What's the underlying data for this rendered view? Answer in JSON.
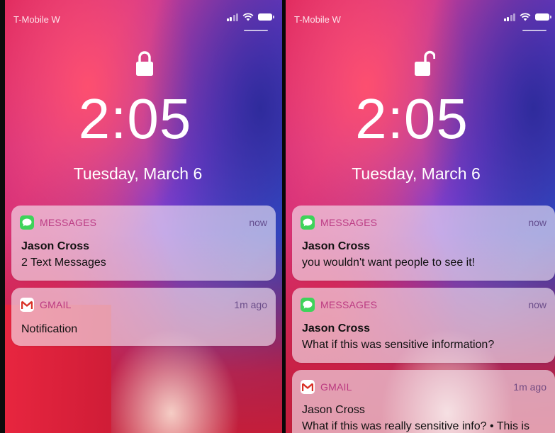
{
  "left": {
    "carrier": "T-Mobile W",
    "time": "2:05",
    "date": "Tuesday, March 6",
    "notifications": [
      {
        "app": "MESSAGES",
        "age": "now",
        "title": "Jason Cross",
        "body": "2 Text Messages"
      },
      {
        "app": "GMAIL",
        "age": "1m ago",
        "title": "",
        "body": "Notification"
      }
    ]
  },
  "right": {
    "carrier": "T-Mobile W",
    "time": "2:05",
    "date": "Tuesday, March 6",
    "notifications": [
      {
        "app": "MESSAGES",
        "age": "now",
        "title": "Jason Cross",
        "body": "you wouldn't want people to see it!"
      },
      {
        "app": "MESSAGES",
        "age": "now",
        "title": "Jason Cross",
        "body": "What if this was sensitive information?"
      },
      {
        "app": "GMAIL",
        "age": "1m ago",
        "title": "Jason Cross",
        "body": "What if this was really sensitive info? • This is"
      }
    ]
  },
  "icons": {
    "lock_left": "lock-closed-icon",
    "lock_right": "lock-open-icon",
    "messages": "messages-app-icon",
    "gmail": "gmail-app-icon",
    "signal": "cellular-signal-icon",
    "wifi": "wifi-icon",
    "battery": "battery-icon"
  },
  "colors": {
    "app_name": "#b42878",
    "messages_icon": "#3ed35a",
    "gmail_red": "#d93025"
  }
}
